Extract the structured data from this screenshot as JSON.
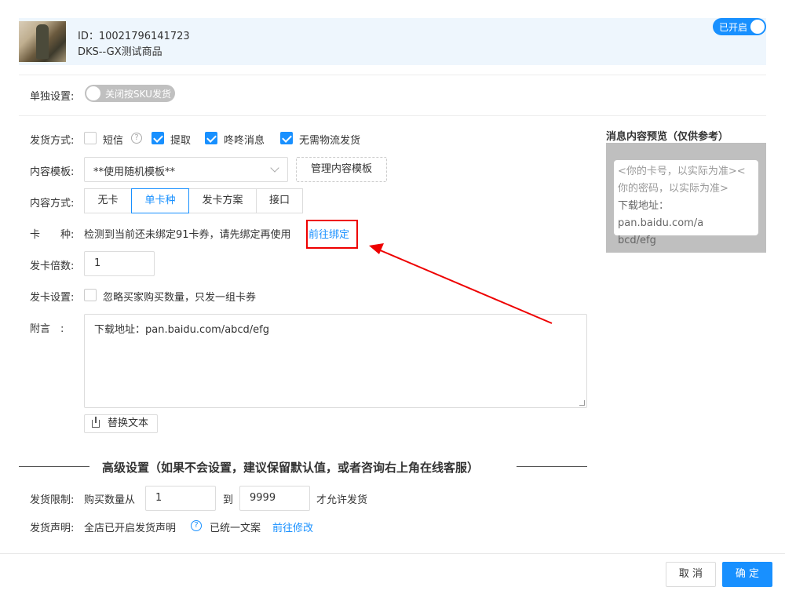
{
  "product": {
    "id_label": "ID：10021796141723",
    "name": "DKS--GX测试商品",
    "status_toggle": "已开启"
  },
  "single_setting": {
    "label": "单独设置:",
    "toggle_text": "关闭按SKU发货"
  },
  "delivery_method": {
    "label": "发货方式:",
    "options": [
      {
        "label": "短信",
        "checked": false
      },
      {
        "label": "提取",
        "checked": true
      },
      {
        "label": "咚咚消息",
        "checked": true
      },
      {
        "label": "无需物流发货",
        "checked": true
      }
    ]
  },
  "content_template": {
    "label": "内容模板:",
    "selected": "**使用随机模板**",
    "manage_button": "管理内容模板"
  },
  "content_method": {
    "label": "内容方式:",
    "options": [
      "无卡",
      "单卡种",
      "发卡方案",
      "接口"
    ],
    "active": "单卡种"
  },
  "card_type": {
    "label": "卡　　种:",
    "message": "检测到当前还未绑定91卡券，请先绑定再使用",
    "link": "前往绑定"
  },
  "card_multiplier": {
    "label": "发卡倍数:",
    "value": "1"
  },
  "card_setting": {
    "label": "发卡设置:",
    "option": "忽略买家购买数量，只发一组卡券",
    "checked": false
  },
  "note": {
    "label": "附言　:",
    "value": "下载地址：pan.baidu.com/abcd/efg",
    "replace_button": "替换文本"
  },
  "advanced": {
    "title": "高级设置（如果不会设置，建议保留默认值，或者咨询右上角在线客服）"
  },
  "delivery_limit": {
    "label": "发货限制:",
    "prefix": "购买数量从",
    "from": "1",
    "to_label": "到",
    "to": "9999",
    "suffix": "才允许发货"
  },
  "delivery_statement": {
    "label": "发货声明:",
    "text": "全店已开启发货声明",
    "status": "已统一文案",
    "link": "前往修改"
  },
  "preview": {
    "title": "消息内容预览（仅供参考）",
    "line1": "<你的卡号，以实际为准><",
    "line2": "你的密码，以实际为准>",
    "line3": "下载地址：pan.baidu.com/a",
    "line4": "bcd/efg"
  },
  "footer": {
    "cancel": "取 消",
    "ok": "确 定"
  },
  "colors": {
    "accent": "#1890ff",
    "annotation": "#ee0000"
  }
}
